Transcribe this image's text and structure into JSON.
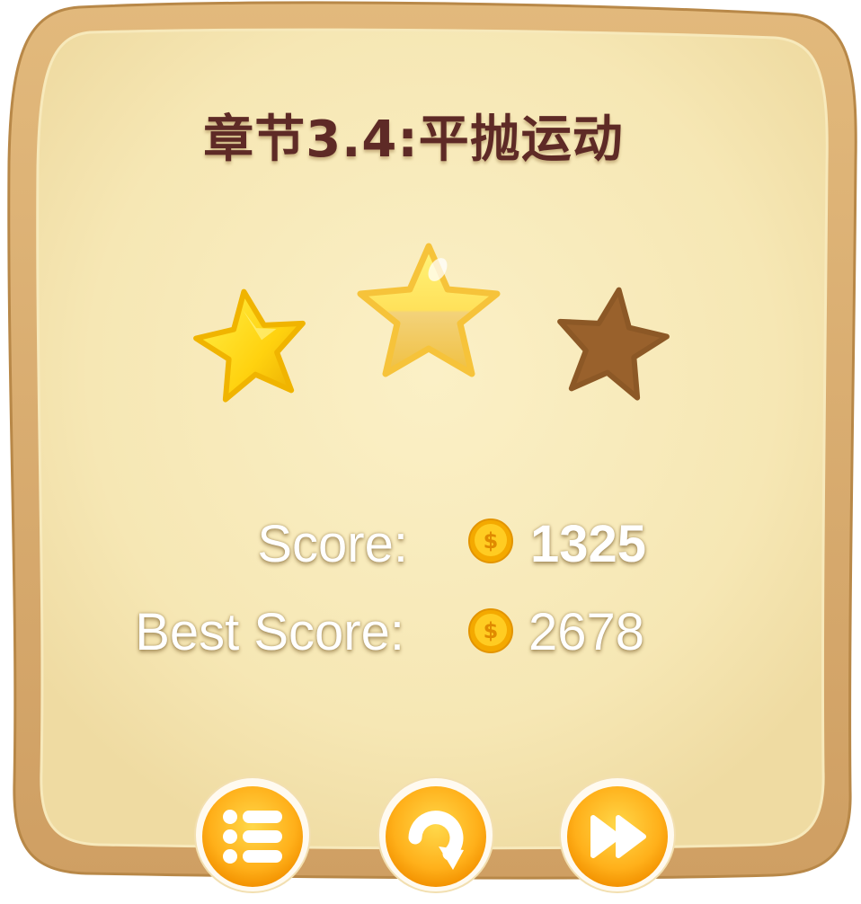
{
  "level_title": "章节3.4:平抛运动",
  "stars": {
    "earned": 2,
    "total": 3
  },
  "score": {
    "label": "Score:",
    "value": "1325",
    "currency_icon": "gold-dollar-coin-icon"
  },
  "best_score": {
    "label": "Best Score:",
    "value": "2678",
    "currency_icon": "gold-dollar-coin-icon"
  },
  "buttons": [
    {
      "name": "menu-list-button",
      "icon": "list-icon"
    },
    {
      "name": "replay-button",
      "icon": "replay-icon"
    },
    {
      "name": "next-level-button",
      "icon": "fast-forward-icon"
    }
  ],
  "colors": {
    "panel_fill": "#f8eab8",
    "panel_border": "#d9ad72",
    "title_text": "#5e2a26",
    "star_gold": "#ffd21a",
    "star_empty": "#9a6530",
    "button_orange": "#ff9d10"
  }
}
